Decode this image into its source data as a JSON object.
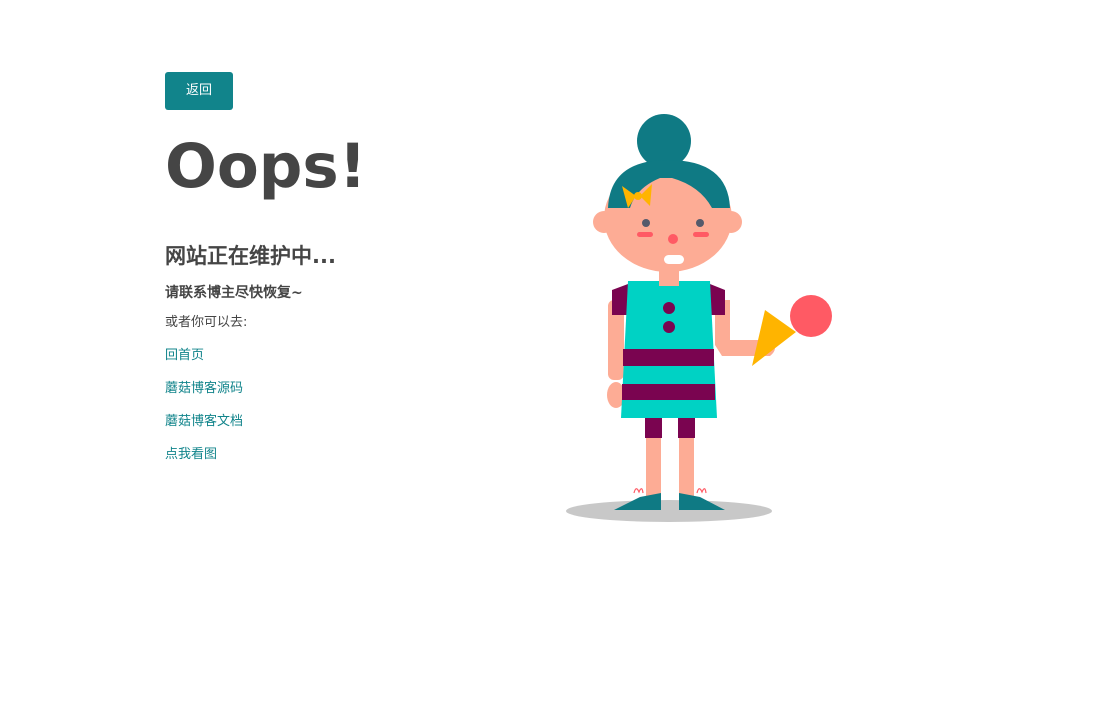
{
  "back_button": {
    "label": "返回"
  },
  "heading": "Oops!",
  "subtitle": "网站正在维护中...",
  "contact_text": "请联系博主尽快恢复~",
  "or_text": "或者你可以去:",
  "links": [
    {
      "label": "回首页"
    },
    {
      "label": "蘑菇博客源码"
    },
    {
      "label": "蘑菇博客文档"
    },
    {
      "label": "点我看图"
    }
  ],
  "colors": {
    "accent": "#11848b",
    "text": "#454545",
    "hair": "#0f7a84",
    "skin": "#fdac95",
    "dress": "#00d2c4",
    "stripe": "#7a0450",
    "ice_cream": "#ff5a64",
    "cone": "#ffb400",
    "shadow": "#c8c8c8"
  },
  "illustration": {
    "icon": "girl-with-ice-cream-illustration"
  }
}
